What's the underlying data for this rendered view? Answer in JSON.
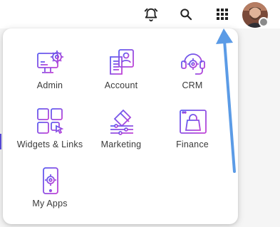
{
  "topbar": {
    "icons": [
      "alarm-bell-icon",
      "search-icon",
      "apps-grid-icon"
    ],
    "avatar_alt": "user-avatar"
  },
  "apps": [
    {
      "label": "Admin",
      "icon": "admin-icon"
    },
    {
      "label": "Account",
      "icon": "account-icon"
    },
    {
      "label": "CRM",
      "icon": "crm-icon"
    },
    {
      "label": "Widgets & Links",
      "icon": "widgets-links-icon"
    },
    {
      "label": "Marketing",
      "icon": "marketing-icon"
    },
    {
      "label": "Finance",
      "icon": "finance-icon"
    },
    {
      "label": "My Apps",
      "icon": "my-apps-icon"
    }
  ],
  "colors": {
    "icon_gradient_start": "#5b5cf0",
    "icon_gradient_end": "#c043d6",
    "annotation_arrow": "#5b9be6"
  }
}
